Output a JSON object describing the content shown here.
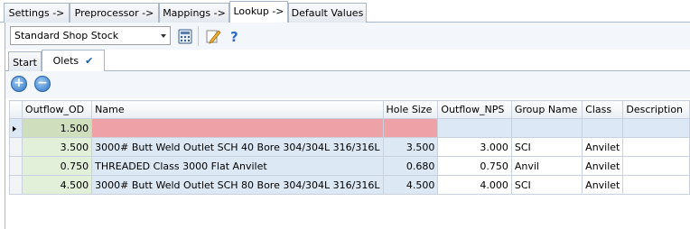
{
  "top_tabs": [
    {
      "label": "Settings ->"
    },
    {
      "label": "Preprocessor ->"
    },
    {
      "label": "Mappings ->"
    },
    {
      "label": "Lookup ->"
    },
    {
      "label": "Default Values"
    }
  ],
  "toolbar": {
    "selected_table": "Standard Shop Stock"
  },
  "sub_tabs": [
    {
      "label": "Start"
    },
    {
      "label": "Olets"
    }
  ],
  "grid": {
    "columns": [
      "Outflow_OD",
      "Name",
      "Hole Size",
      "Outflow_NPS",
      "Group Name",
      "Class",
      "Description"
    ],
    "rows": [
      {
        "od": "1.500",
        "name": "",
        "hole": "",
        "nps": "",
        "group": "",
        "class": "",
        "desc": ""
      },
      {
        "od": "3.500",
        "name": "3000# Butt Weld Outlet SCH 40 Bore 304/304L 316/316L",
        "hole": "3.500",
        "nps": "3.000",
        "group": "SCI",
        "class": "Anvilet",
        "desc": ""
      },
      {
        "od": "0.750",
        "name": "THREADED Class 3000 Flat Anvilet",
        "hole": "0.680",
        "nps": "0.750",
        "group": "Anvil",
        "class": "Anvilet",
        "desc": ""
      },
      {
        "od": "4.500",
        "name": "3000# Butt Weld Outlet SCH 80 Bore 304/304L 316/316L",
        "hole": "4.500",
        "nps": "4.000",
        "group": "SCI",
        "class": "Anvilet",
        "desc": ""
      }
    ]
  },
  "colors": {
    "od_column": "#e2efd9",
    "hole_column": "#dce8f4",
    "invalid_cell": "#eea2a8",
    "current_row": "#dde8f7"
  }
}
